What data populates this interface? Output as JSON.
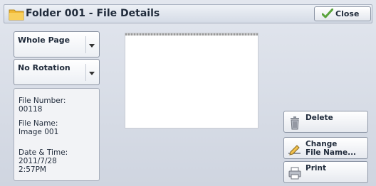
{
  "header": {
    "title": "Folder 001 - File Details",
    "close_label": "Close"
  },
  "controls": {
    "scale_select": "Whole Page",
    "rotation_select": "No Rotation"
  },
  "details": {
    "file_number_label": "File Number:",
    "file_number": "00118",
    "file_name_label": "File Name:",
    "file_name": "Image 001",
    "date_time_label": "Date & Time:",
    "date": "2011/7/28",
    "time": "2:57PM"
  },
  "actions": {
    "delete_label": "Delete",
    "change_name_line1": "Change",
    "change_name_line2": "File Name...",
    "print_label": "Print"
  },
  "colors": {
    "folder": "#f5c24a",
    "check": "#6ab04c"
  },
  "icons": [
    "folder-icon",
    "checkmark-icon",
    "trash-icon",
    "pencil-icon",
    "printer-icon",
    "chevron-down-icon"
  ]
}
